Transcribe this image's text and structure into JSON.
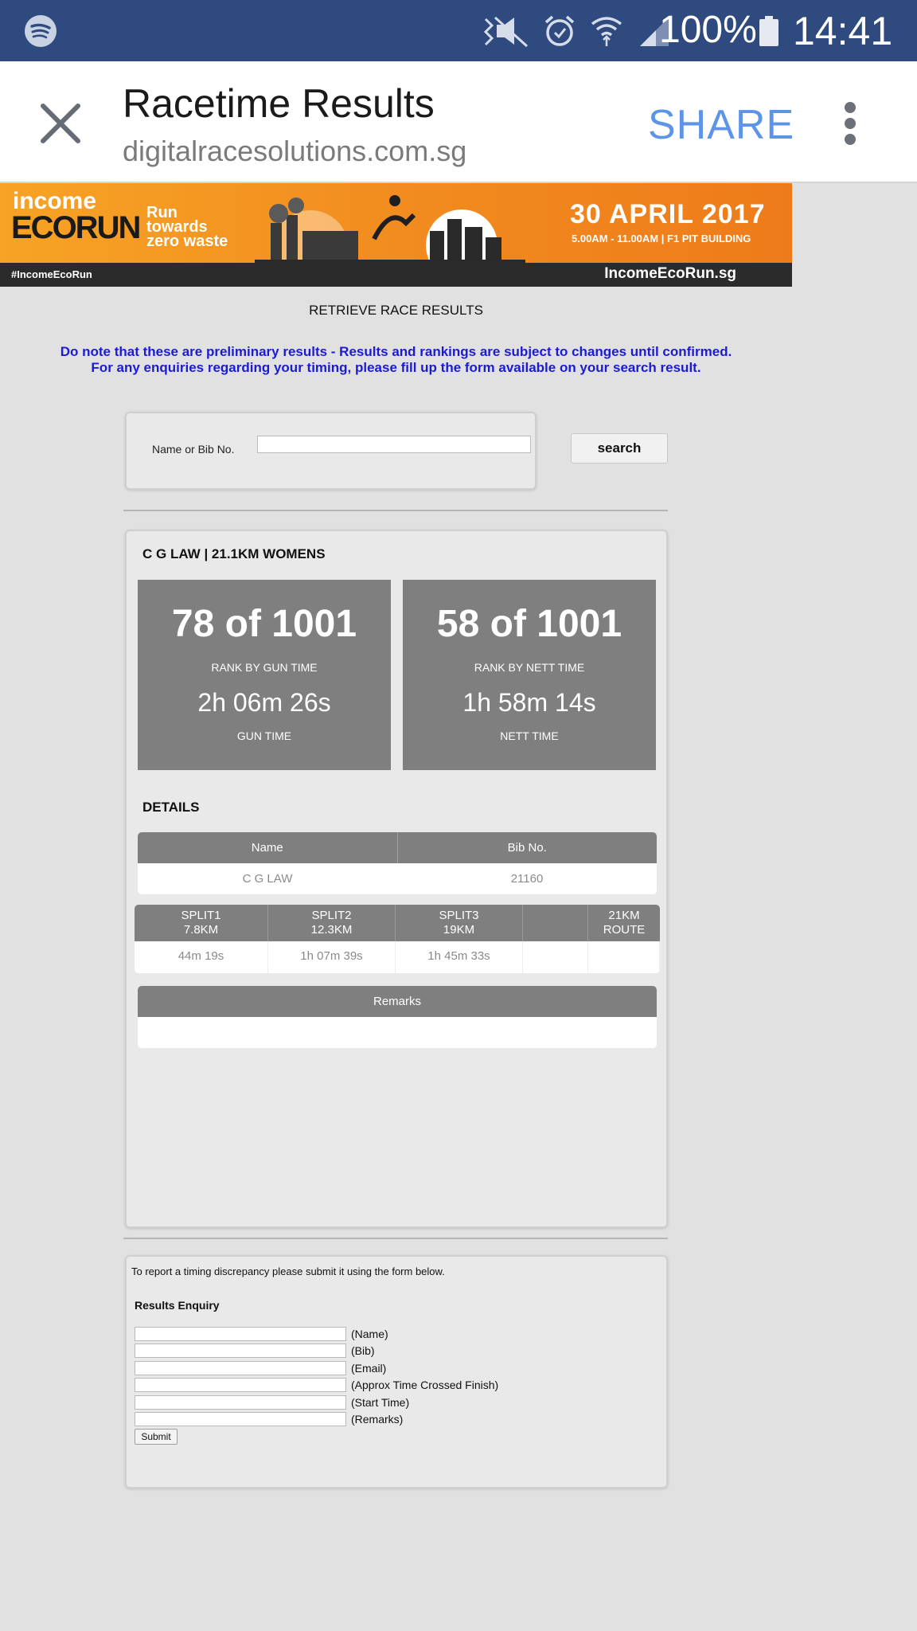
{
  "status_bar": {
    "battery": "100%",
    "time": "14:41",
    "icons": [
      "spotify-icon",
      "mute-icon",
      "alarm-icon",
      "wifi-icon",
      "signal-icon",
      "battery-icon"
    ]
  },
  "app_bar": {
    "title": "Racetime Results",
    "domain": "digitalracesolutions.com.sg",
    "share_label": "SHARE"
  },
  "banner": {
    "logo_top": "income",
    "logo_bottom": "ECORUN",
    "tagline": "Run towards zero waste",
    "date": "30 APRIL 2017",
    "time_venue": "5.00AM - 11.00AM  |  F1 PIT BUILDING",
    "hashtag": "#IncomeEcoRun",
    "site": "IncomeEcoRun.sg"
  },
  "page": {
    "heading": "RETRIEVE RACE RESULTS",
    "notice_line1": "Do note that these are preliminary results - Results and rankings are subject to changes until confirmed.",
    "notice_line2": "For any enquiries regarding your timing, please fill up the form available on your search result."
  },
  "search": {
    "label": "Name or Bib No.",
    "value": "",
    "button": "search"
  },
  "result": {
    "header": "C G LAW | 21.1KM WOMENS",
    "gun": {
      "rank": "78 of 1001",
      "rank_label": "RANK BY GUN TIME",
      "time": "2h 06m 26s",
      "time_label": "GUN TIME"
    },
    "nett": {
      "rank": "58 of 1001",
      "rank_label": "RANK BY NETT TIME",
      "time": "1h 58m 14s",
      "time_label": "NETT TIME"
    },
    "details_label": "DETAILS",
    "name_table": {
      "headers": [
        "Name",
        "Bib No."
      ],
      "values": [
        "C G LAW",
        "21160"
      ]
    },
    "split_table": {
      "headers": [
        {
          "line1": "SPLIT1",
          "line2": "7.8KM"
        },
        {
          "line1": "SPLIT2",
          "line2": "12.3KM"
        },
        {
          "line1": "SPLIT3",
          "line2": "19KM"
        },
        {
          "line1": "",
          "line2": ""
        },
        {
          "line1": "21KM",
          "line2": "ROUTE"
        }
      ],
      "values": [
        "44m 19s",
        "1h 07m 39s",
        "1h 45m 33s",
        "",
        ""
      ]
    },
    "remarks_table": {
      "header": "Remarks",
      "value": ""
    }
  },
  "enquiry": {
    "intro": "To report a timing discrepancy please submit it using the form below.",
    "title": "Results Enquiry",
    "fields": [
      "(Name)",
      "(Bib)",
      "(Email)",
      "(Approx Time Crossed Finish)",
      "(Start Time)",
      "(Remarks)"
    ],
    "submit": "Submit"
  },
  "colors": {
    "status_bar": "#2f4a7f",
    "share": "#5e94e8",
    "notice": "#1b1bd6",
    "stat_box": "#7f7f7f",
    "banner": "#f18a1f"
  }
}
